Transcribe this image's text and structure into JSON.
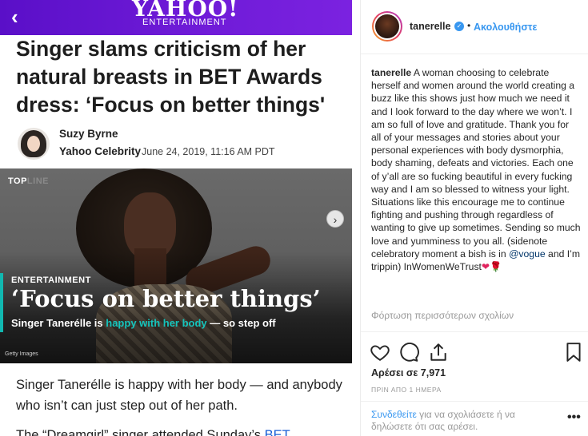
{
  "article": {
    "back_icon": "chevron-left-icon",
    "logo": "YAHOO!",
    "logo_sub": "ENTERTAINMENT",
    "headline": "Singer slams criticism of her natural breasts in BET Awards dress: ‘Focus on better things'",
    "author": "Suzy Byrne",
    "source": "Yahoo Celebrity",
    "date": "June 24, 2019, 11:16 AM PDT",
    "hero": {
      "topline_a": "TOP",
      "topline_b": "LINE",
      "category": "ENTERTAINMENT",
      "quote": "‘Focus on better things’",
      "sub_a": "Singer Tanerélle is ",
      "sub_highlight": "happy with her body",
      "sub_b": " — so step off",
      "credit": "Getty Images",
      "next_icon": "chevron-right-icon"
    },
    "body1": "Singer Tanerélle is happy with her body — and anybody who isn’t can just step out of her path.",
    "body2_a": "The “Dreamgirl” singer attended Sunday’s ",
    "body2_link": "BET"
  },
  "instagram": {
    "username": "tanerelle",
    "verified_icon": "verified-badge-icon",
    "dot": "•",
    "follow": "Ακολουθήστε",
    "caption_user": "tanerelle",
    "caption_a": "A woman choosing to celebrate herself and women around the world creating a buzz like this shows just how much we need it and I look forward to the day where we won’t. I am so full of love and gratitude. Thank you for all of your messages and stories about your personal experiences with body dysmorphia, body shaming, defeats and victories. Each one of y’all are so fucking beautiful in every fucking way and I am so blessed to witness your light. Situations like this encourage me to continue fighting and pushing through regardless of wanting to give up sometimes. Sending so much love and yumminess to you all. (sidenote celebratory moment a bish is in ",
    "caption_mention": "@vogue",
    "caption_b": " and I’m trippin) InWomenWeTrust",
    "caption_emoji": "❤🌹",
    "more_comments": "Φόρτωση περισσότερων σχολίων",
    "actions": [
      "heart-icon",
      "comment-icon",
      "share-icon",
      "bookmark-icon"
    ],
    "likes": "Αρέσει σε 7,971",
    "time_ago": "ΠΡΙΝ ΑΠΟ 1 ΗΜΕΡΑ",
    "login_link": "Συνδεθείτε",
    "login_rest": " για να σχολιάσετε ή να δηλώσετε ότι σας αρέσει.",
    "more_icon": "more-options-icon",
    "more_glyph": "•••"
  },
  "colors": {
    "yahoo_purple": "#6d1ad6",
    "teal_accent": "#11b8b0",
    "ig_blue": "#3897f0"
  }
}
